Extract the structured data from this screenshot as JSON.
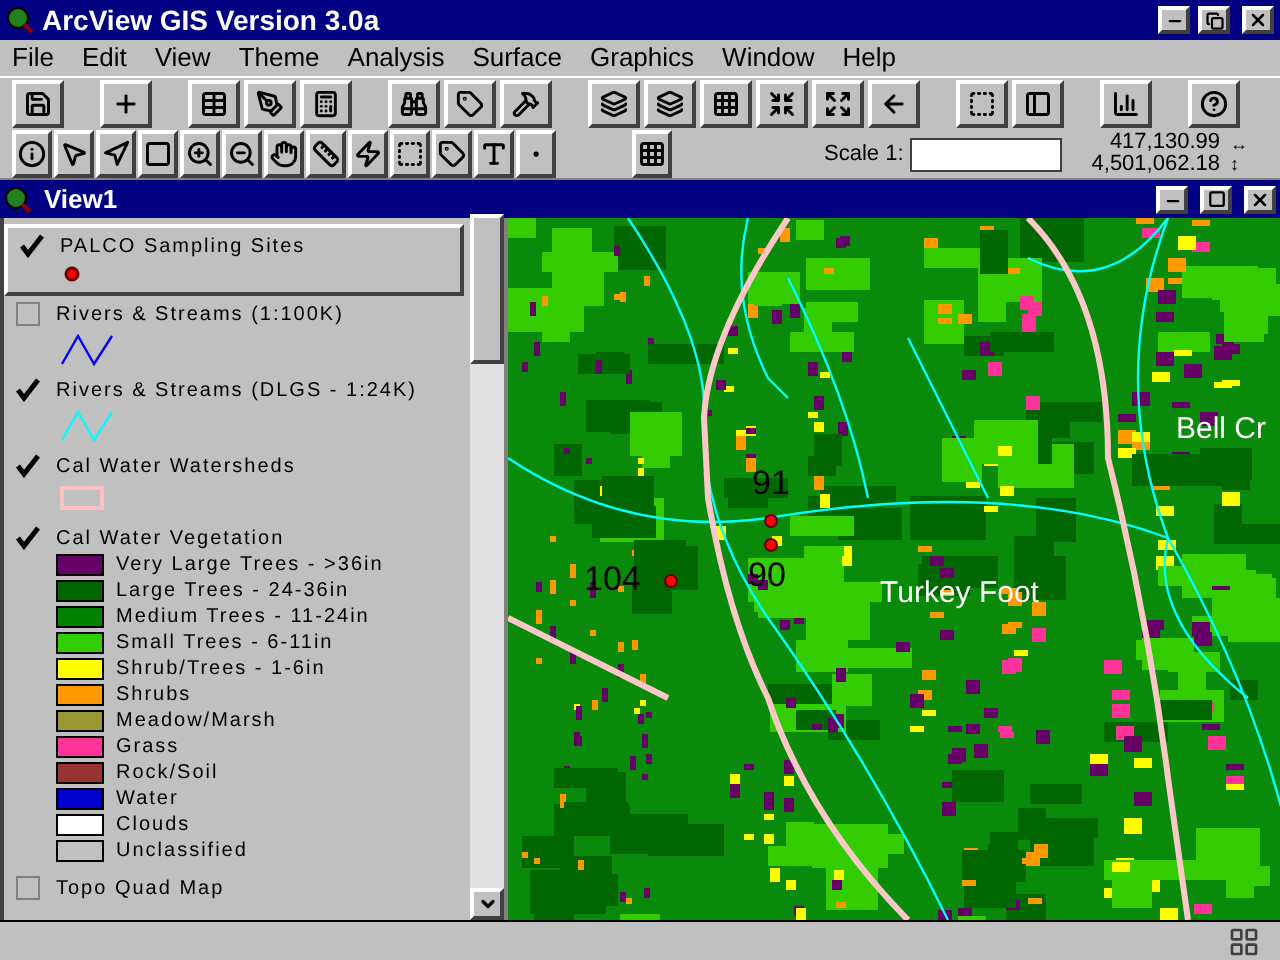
{
  "window": {
    "title": "ArcView GIS Version 3.0a"
  },
  "menus": [
    "File",
    "Edit",
    "View",
    "Theme",
    "Analysis",
    "Surface",
    "Graphics",
    "Window",
    "Help"
  ],
  "scale": {
    "label": "Scale 1:",
    "x_coordinate": "417,130.99",
    "x_arrow": "↔",
    "y_coordinate": "4,501,062.18",
    "y_arrow": "↕"
  },
  "view": {
    "title": "View1",
    "themes": [
      {
        "name": "PALCO Sampling Sites",
        "checked": true,
        "selected": true,
        "kind": "point",
        "color": "#ff0000"
      },
      {
        "name": "Rivers & Streams (1:100K)",
        "checked": false,
        "selected": false,
        "kind": "line",
        "color": "#0000ff"
      },
      {
        "name": "Rivers & Streams (DLGS - 1:24K)",
        "checked": true,
        "selected": false,
        "kind": "line",
        "color": "#00ffff"
      },
      {
        "name": "Cal Water Watersheds",
        "checked": true,
        "selected": false,
        "kind": "polygon",
        "color": "#ffc0c0"
      },
      {
        "name": "Cal Water Vegetation",
        "checked": true,
        "selected": false,
        "kind": "classes",
        "classes": [
          {
            "label": "Very Large Trees - >36in",
            "color": "#660066"
          },
          {
            "label": "Large Trees - 24-36in",
            "color": "#006600"
          },
          {
            "label": "Medium Trees - 11-24in",
            "color": "#008000"
          },
          {
            "label": "Small Trees - 6-11in",
            "color": "#33cc00"
          },
          {
            "label": "Shrub/Trees - 1-6in",
            "color": "#ffff00"
          },
          {
            "label": "Shrubs",
            "color": "#ff9900"
          },
          {
            "label": "Meadow/Marsh",
            "color": "#999933"
          },
          {
            "label": "Grass",
            "color": "#ff3399"
          },
          {
            "label": "Rock/Soil",
            "color": "#993333"
          },
          {
            "label": "Water",
            "color": "#0000cc"
          },
          {
            "label": "Clouds",
            "color": "#ffffff"
          },
          {
            "label": "Unclassified",
            "color": "#c0c0c0"
          }
        ]
      },
      {
        "name": "Topo Quad Map",
        "checked": false,
        "selected": false,
        "kind": "image"
      }
    ],
    "map": {
      "sites": [
        {
          "label": "91"
        },
        {
          "label": "104"
        },
        {
          "label": "90"
        }
      ],
      "places": [
        {
          "label": "Turkey Foot"
        },
        {
          "label": "Bell Cr"
        }
      ]
    }
  }
}
